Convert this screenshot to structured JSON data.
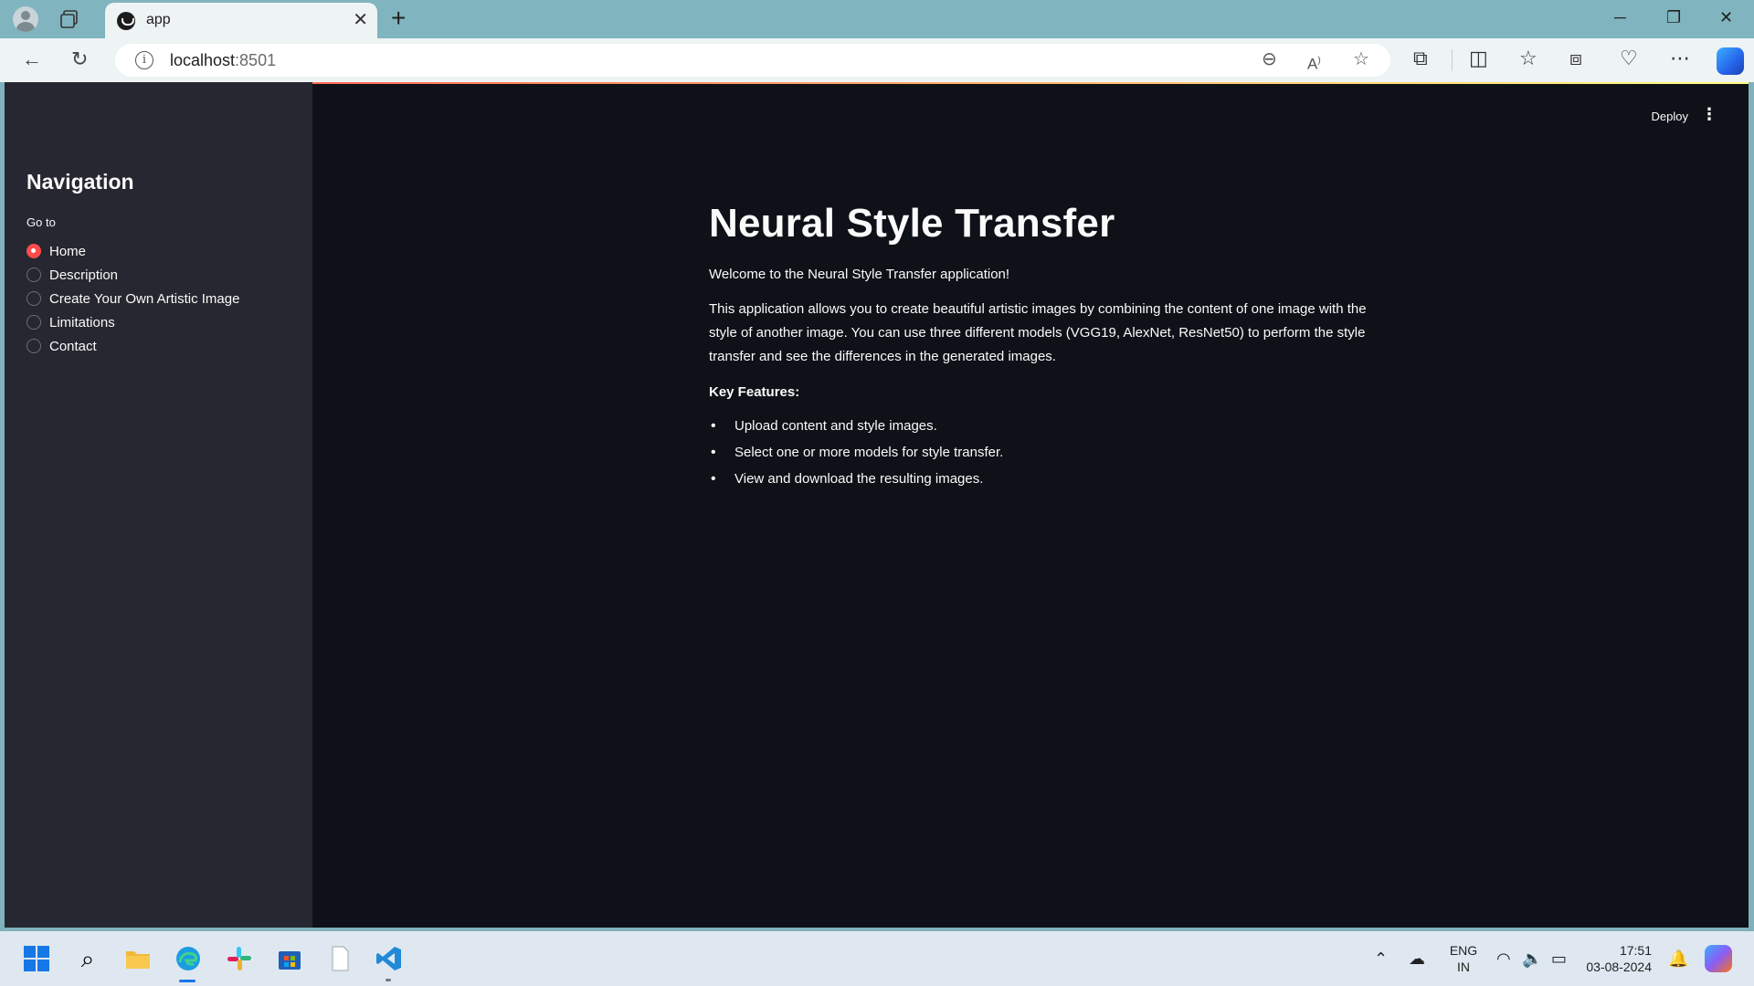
{
  "browser": {
    "tab_title": "app",
    "url_host": "localhost",
    "url_port": ":8501"
  },
  "app": {
    "deploy_label": "Deploy",
    "sidebar": {
      "title": "Navigation",
      "radio_label": "Go to",
      "options": [
        "Home",
        "Description",
        "Create Your Own Artistic Image",
        "Limitations",
        "Contact"
      ],
      "selected": "Home"
    },
    "main": {
      "title": "Neural Style Transfer",
      "welcome": "Welcome to the Neural Style Transfer application!",
      "description": "This application allows you to create beautiful artistic images by combining the content of one image with the style of another image. You can use three different models (VGG19, AlexNet, ResNet50) to perform the style transfer and see the differences in the generated images.",
      "key_features_label": "Key Features:",
      "features": [
        "Upload content and style images.",
        "Select one or more models for style transfer.",
        "View and download the resulting images."
      ]
    },
    "accent_color": "#ff4b4b"
  },
  "taskbar": {
    "language": "ENG",
    "region": "IN",
    "time": "17:51",
    "date": "03-08-2024"
  }
}
